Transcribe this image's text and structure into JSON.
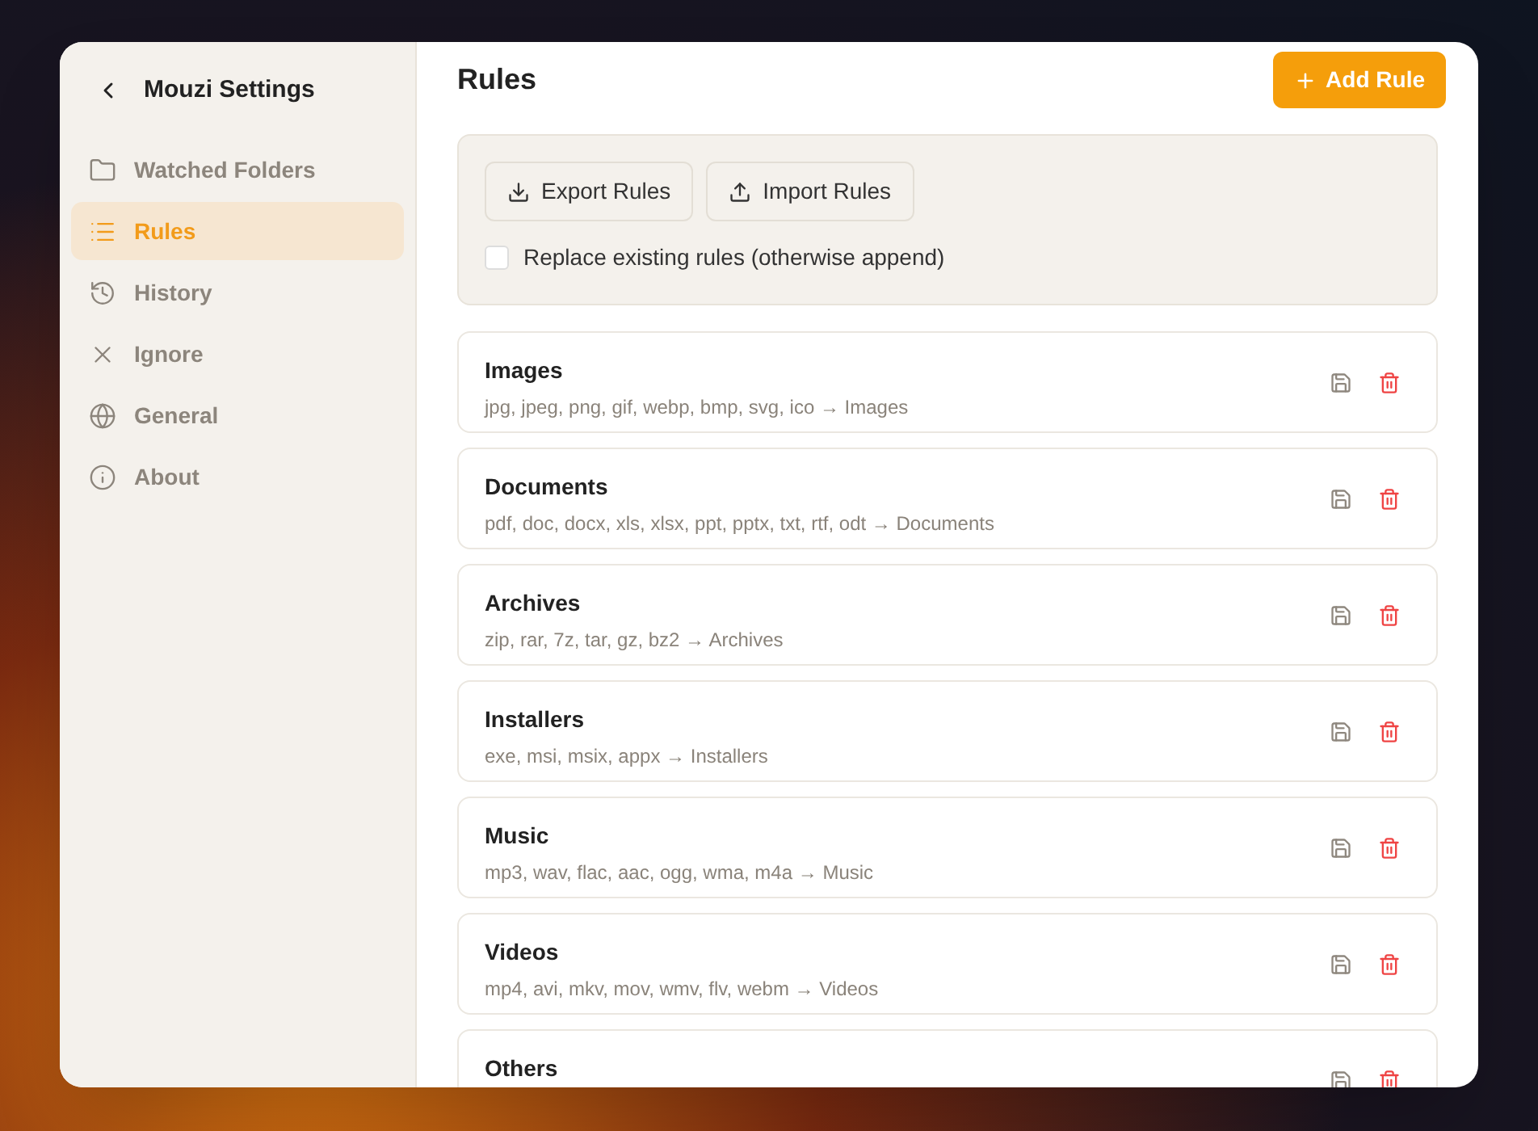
{
  "sidebar": {
    "title": "Mouzi Settings",
    "items": [
      {
        "label": "Watched Folders",
        "selected": false
      },
      {
        "label": "Rules",
        "selected": true
      },
      {
        "label": "History",
        "selected": false
      },
      {
        "label": "Ignore",
        "selected": false
      },
      {
        "label": "General",
        "selected": false
      },
      {
        "label": "About",
        "selected": false
      }
    ]
  },
  "header": {
    "title": "Rules",
    "add_button": "Add Rule"
  },
  "import_export": {
    "export_button": "Export Rules",
    "import_button": "Import Rules",
    "replace_checkbox": {
      "label": "Replace existing rules (otherwise append)",
      "checked": false
    }
  },
  "rules": [
    {
      "name": "Images",
      "description": "jpg, jpeg, png, gif, webp, bmp, svg, ico → Images"
    },
    {
      "name": "Documents",
      "description": "pdf, doc, docx, xls, xlsx, ppt, pptx, txt, rtf, odt → Documents"
    },
    {
      "name": "Archives",
      "description": "zip, rar, 7z, tar, gz, bz2 → Archives"
    },
    {
      "name": "Installers",
      "description": "exe, msi, msix, appx → Installers"
    },
    {
      "name": "Music",
      "description": "mp3, wav, flac, aac, ogg, wma, m4a → Music"
    },
    {
      "name": "Videos",
      "description": "mp4, avi, mkv, mov, wmv, flv, webm → Videos"
    },
    {
      "name": "Others"
    }
  ]
}
